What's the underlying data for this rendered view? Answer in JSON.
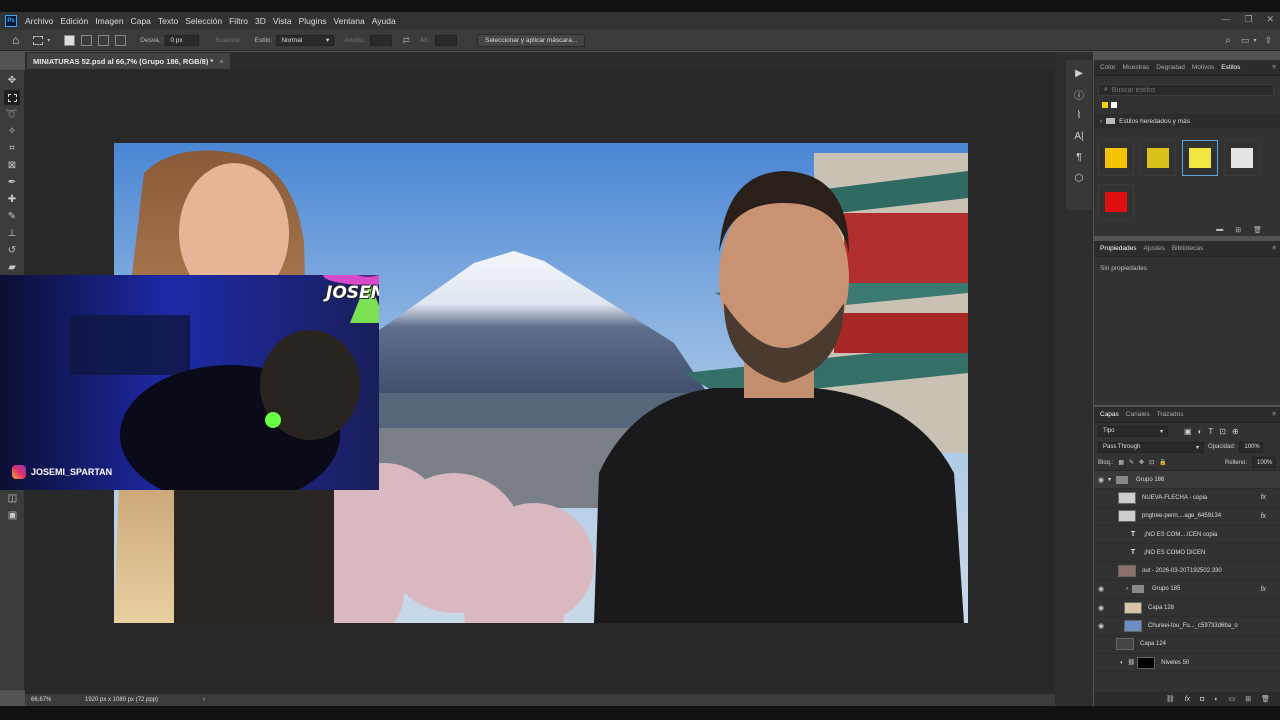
{
  "app": {
    "logo": "Ps"
  },
  "menu": [
    "Archivo",
    "Edición",
    "Imagen",
    "Capa",
    "Texto",
    "Selección",
    "Filtro",
    "3D",
    "Vista",
    "Plugins",
    "Ventana",
    "Ayuda"
  ],
  "options": {
    "desvan_label": "Desva.:",
    "desvan_value": "0 px",
    "suavizar_label": "Suavizar",
    "estilo_label": "Estilo:",
    "estilo_value": "Normal",
    "anchura_label": "Anchu.:",
    "altura_label": "Alt.:",
    "mask_button": "Seleccionar y aplicar máscara..."
  },
  "document": {
    "tab_title": "MINIATURAS 52.psd al 66,7% (Grupo 186, RGB/8) *",
    "close": "×"
  },
  "artwork": {
    "webcam_handle": "JOSEMI_SPARTAN",
    "logo_text": "JOSEMI"
  },
  "status": {
    "zoom": "66,67%",
    "doc_info": "1920 px x 1080 px (72 ppp)",
    "arrow": "›"
  },
  "styles_panel": {
    "tabs": [
      "Color",
      "Muestras",
      "Degradad",
      "Motivos",
      "Estilos"
    ],
    "active_tab": "Estilos",
    "search_placeholder": "Buscar estilos",
    "folder_label": "Estilos heredados y más",
    "swatch_colors": [
      "#f5c400",
      "#d9c21a",
      "#f3e542",
      "#e4e4e4",
      "#e01010"
    ]
  },
  "properties_panel": {
    "tabs": [
      "Propiedades",
      "Ajustes",
      "Bibliotecas"
    ],
    "active_tab": "Propiedades",
    "empty_text": "Sin propiedades"
  },
  "layers_panel": {
    "tabs": [
      "Capas",
      "Canales",
      "Trazados"
    ],
    "active_tab": "Capas",
    "filter_value": "Tipo",
    "blend_mode": "Pass Through",
    "opacity_label": "Opacidad:",
    "opacity_value": "100%",
    "lock_label": "Bloq.:",
    "fill_label": "Relleno:",
    "fill_value": "100%",
    "layers": [
      {
        "name": "Grupo 186",
        "kind": "group"
      },
      {
        "name": "NUEVA-FLECHA - copia",
        "kind": "image"
      },
      {
        "name": "pngtree-penn....age_6459134",
        "kind": "image"
      },
      {
        "name": "¡NO ES COM....ICEN copia",
        "kind": "text",
        "thumb": "T"
      },
      {
        "name": "¡NO ES COMO DICEN",
        "kind": "text",
        "thumb": "T"
      },
      {
        "name": "out - 2026-03-20T192502.330",
        "kind": "image"
      },
      {
        "name": "Grupo 185",
        "kind": "group"
      },
      {
        "name": "Capa 128",
        "kind": "image"
      },
      {
        "name": "Chureei-tou_Fu..._c59733d6ba_o",
        "kind": "image"
      },
      {
        "name": "Capa 124",
        "kind": "image"
      },
      {
        "name": "Niveles 50",
        "kind": "adjustment"
      }
    ],
    "fx_label": "fx"
  }
}
